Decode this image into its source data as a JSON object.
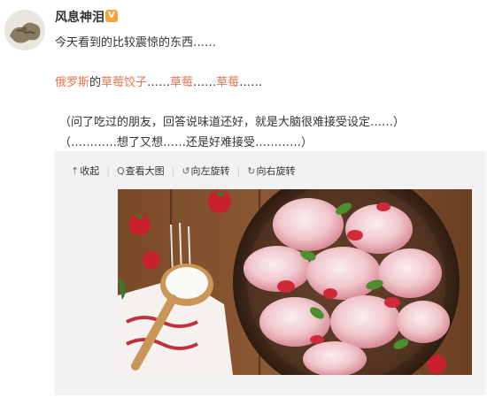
{
  "user": {
    "name": "风息神泪",
    "badge": "V"
  },
  "post": {
    "line1": "今天看到的比较震惊的东西……",
    "line2_prefix": "俄罗斯",
    "line2_de": "的",
    "line2_link": "草莓饺子",
    "line2_dots1": "……",
    "line2_berry1": "草莓",
    "line2_dots2": "……",
    "line2_berry2": "草莓",
    "line2_dots3": "……",
    "line3": "（问了吃过的朋友，回答说味道还好，就是大脑很难接受设定……）",
    "line4": "（…………想了又想……还是好难接受…………）"
  },
  "toolbar": {
    "collapse": "收起",
    "view_large": "查看大图",
    "rotate_left": "向左旋转",
    "rotate_right": "向右旋转"
  },
  "photo": {
    "subject": "strawberry-dumplings-photo"
  },
  "colors": {
    "accent": "#eb7350",
    "media_bg": "#f2f2f5",
    "badge": "#f3a537"
  }
}
